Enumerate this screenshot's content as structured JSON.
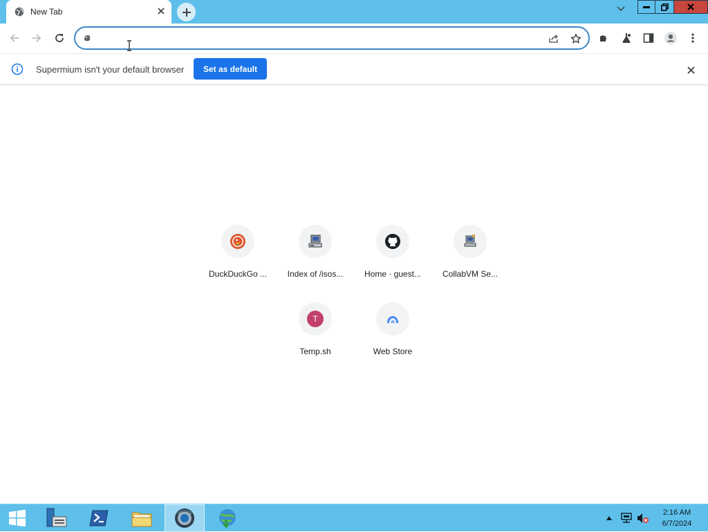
{
  "browser": {
    "tab": {
      "title": "New Tab"
    },
    "omnibox": {
      "value": "",
      "placeholder": ""
    },
    "infobar": {
      "message": "Supermium isn't your default browser",
      "button_label": "Set as default"
    },
    "shortcuts": [
      {
        "label": "DuckDuckGo ...",
        "icon": "duckduckgo-icon"
      },
      {
        "label": "Index of /isos...",
        "icon": "computer-icon"
      },
      {
        "label": "Home · guest...",
        "icon": "github-icon"
      },
      {
        "label": "CollabVM Se...",
        "icon": "collabvm-icon"
      },
      {
        "label": "Temp.sh",
        "icon": "letter-t-icon",
        "letter": "T"
      },
      {
        "label": "Web Store",
        "icon": "web-store-icon"
      }
    ]
  },
  "taskbar": {
    "clock_time": "2:16 AM",
    "clock_date": "6/7/2024"
  },
  "colors": {
    "tabstrip": "#5ec0ea",
    "accent_blue": "#1a73e8",
    "omnibox_border": "#3b86c6",
    "close_red": "#c7463e",
    "temp_sh_badge": "#c2416b"
  }
}
